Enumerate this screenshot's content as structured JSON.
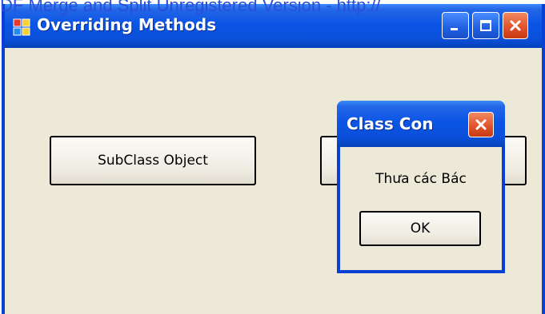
{
  "watermark": "DF Merge and Split Unregistered Version - http://",
  "window": {
    "title": "Overriding Methods",
    "app_icon": "app-window-icon",
    "controls": [
      "minimize-icon",
      "maximize-icon",
      "close-icon"
    ]
  },
  "main": {
    "subclass_button_label": "SubClass Object"
  },
  "dialog": {
    "title": "Class Con",
    "message": "Thưa các Bác",
    "ok_label": "OK"
  },
  "colors": {
    "titlebar_blue": "#0a4fd8",
    "window_face": "#ece9d8",
    "close_red": "#e0502a",
    "watermark_text": "#2a4fd6"
  }
}
